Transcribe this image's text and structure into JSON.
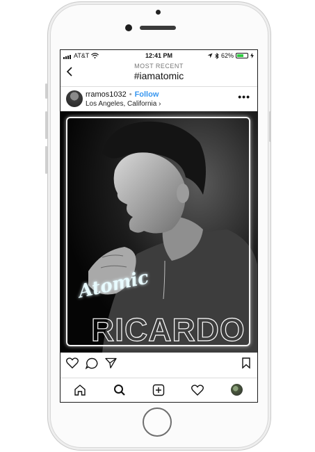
{
  "status_bar": {
    "carrier": "AT&T",
    "time": "12:41 PM",
    "battery": "62%",
    "battery_level": 0.62
  },
  "header": {
    "subtitle": "MOST RECENT",
    "title": "#iamatomic"
  },
  "post": {
    "username": "rramos1032",
    "separator": "•",
    "follow_label": "Follow",
    "location": "Los Angeles, California",
    "location_chevron": "›",
    "more_label": "•••",
    "image_title": "Atomic",
    "image_name": "RICARDO"
  },
  "icons": {
    "back": "chevron-left-icon",
    "wifi": "wifi-icon",
    "location_arrow": "location-arrow-icon",
    "bluetooth": "bluetooth-icon",
    "battery": "battery-icon",
    "like": "heart-icon",
    "comment": "comment-icon",
    "share": "paper-plane-icon",
    "save": "bookmark-icon",
    "home": "home-icon",
    "search": "search-icon",
    "add": "add-post-icon",
    "activity": "heart-outline-icon",
    "profile": "profile-avatar-icon"
  },
  "colors": {
    "follow": "#3897f0",
    "battery_fill": "#2ecc40",
    "atomic_glow": "#33c9ff"
  }
}
